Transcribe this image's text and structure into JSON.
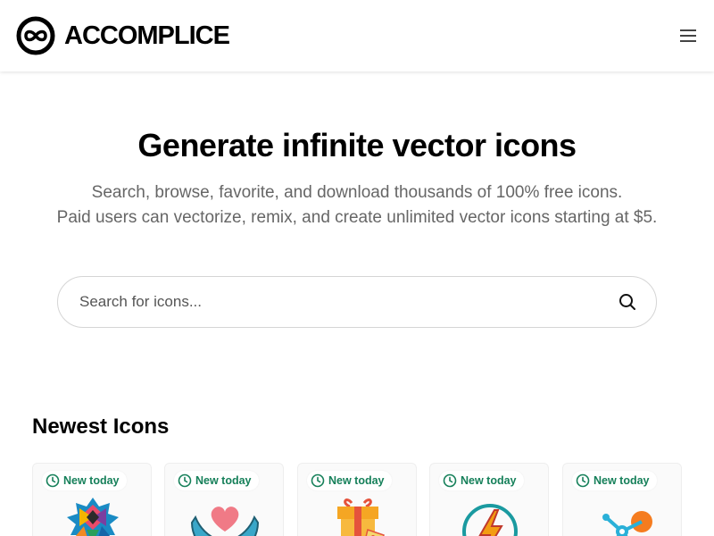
{
  "brand": {
    "name": "ACCOMPLICE"
  },
  "header": {
    "menu_icon": "hamburger-menu-icon"
  },
  "hero": {
    "title": "Generate infinite vector icons",
    "subtitle_line1": "Search, browse, favorite, and download thousands of 100% free icons.",
    "subtitle_line2": "Paid users can vectorize, remix, and create unlimited vector icons starting at $5."
  },
  "search": {
    "placeholder": "Search for icons...",
    "value": "",
    "icon": "search-icon"
  },
  "newest": {
    "title": "Newest Icons",
    "cards": [
      {
        "badge": "New today",
        "icon": "geometric-pattern-icon"
      },
      {
        "badge": "New today",
        "icon": "heart-in-hands-icon"
      },
      {
        "badge": "New today",
        "icon": "gift-box-icon"
      },
      {
        "badge": "New today",
        "icon": "lightning-bolt-icon"
      },
      {
        "badge": "New today",
        "icon": "network-node-icon"
      }
    ]
  },
  "colors": {
    "badge_green": "#16805a",
    "subtitle_gray": "#666666",
    "brand_black": "#000000"
  }
}
